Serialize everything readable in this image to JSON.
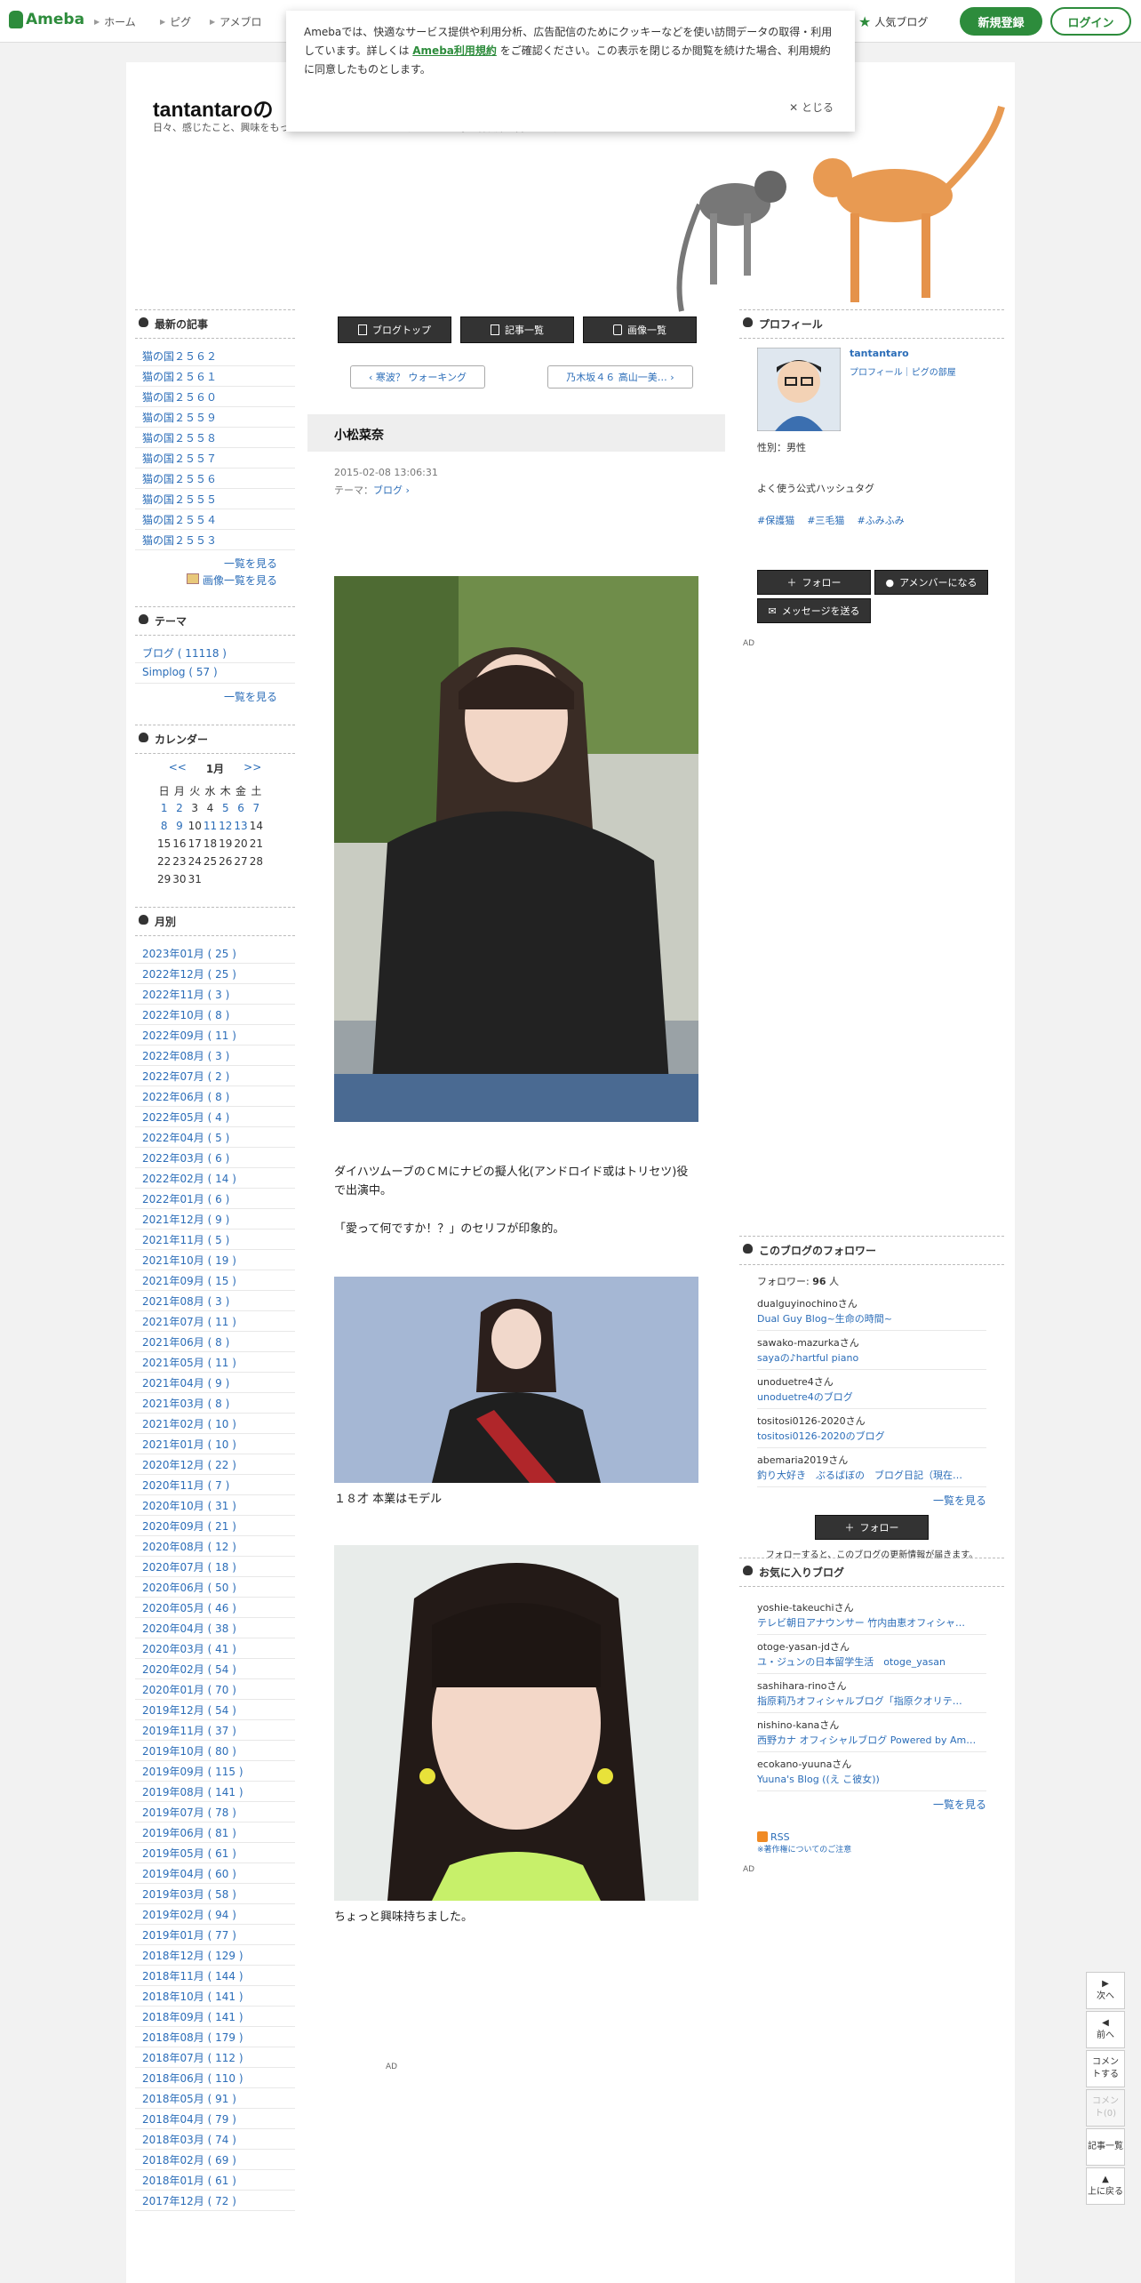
{
  "topbar": {
    "logo": "Ameba",
    "nav": [
      "ホーム",
      "ピグ",
      "アメブロ"
    ],
    "popular": "人気ブログ",
    "register": "新規登録",
    "login": "ログイン"
  },
  "cookie": {
    "text_before": "Amebaでは、快適なサービス提供や利用分析、広告配信のためにクッキーなどを使い訪問データの取得・利用しています。詳しくは ",
    "link": "Ameba利用規約",
    "text_after": " をご確認ください。この表示を閉じるか閲覧を続けた場合、利用規約に同意したものとします。",
    "close": "✕ とじる"
  },
  "blog": {
    "title": "tantantaroの",
    "description": "日々、感じたこと、興味をもったこと、… となっています。それでも時々猫以外も書きます。"
  },
  "latest": {
    "heading": "最新の記事",
    "items": [
      "猫の国２５６２",
      "猫の国２５６１",
      "猫の国２５６０",
      "猫の国２５５９",
      "猫の国２５５８",
      "猫の国２５５７",
      "猫の国２５５６",
      "猫の国２５５５",
      "猫の国２５５４",
      "猫の国２５５３"
    ],
    "more": "一覧を見る",
    "images": "画像一覧を見る"
  },
  "theme": {
    "heading": "テーマ",
    "items": [
      "ブログ ( 11118 )",
      "Simplog ( 57 )"
    ],
    "more": "一覧を見る"
  },
  "calendar": {
    "heading": "カレンダー",
    "prev": "<<",
    "month": "1月",
    "next": ">>",
    "days": [
      "日",
      "月",
      "火",
      "水",
      "木",
      "金",
      "土"
    ],
    "weeks": [
      [
        "1",
        "2",
        "3",
        "4",
        "5",
        "6",
        "7"
      ],
      [
        "8",
        "9",
        "10",
        "11",
        "12",
        "13",
        "14"
      ],
      [
        "15",
        "16",
        "17",
        "18",
        "19",
        "20",
        "21"
      ],
      [
        "22",
        "23",
        "24",
        "25",
        "26",
        "27",
        "28"
      ],
      [
        "29",
        "30",
        "31",
        "",
        "",
        "",
        ""
      ]
    ],
    "linked": [
      "1",
      "2",
      "5",
      "6",
      "7",
      "8",
      "9",
      "11",
      "12",
      "13"
    ]
  },
  "monthly": {
    "heading": "月別",
    "items": [
      "2023年01月 ( 25 )",
      "2022年12月 ( 25 )",
      "2022年11月 ( 3 )",
      "2022年10月 ( 8 )",
      "2022年09月 ( 11 )",
      "2022年08月 ( 3 )",
      "2022年07月 ( 2 )",
      "2022年06月 ( 8 )",
      "2022年05月 ( 4 )",
      "2022年04月 ( 5 )",
      "2022年03月 ( 6 )",
      "2022年02月 ( 14 )",
      "2022年01月 ( 6 )",
      "2021年12月 ( 9 )",
      "2021年11月 ( 5 )",
      "2021年10月 ( 19 )",
      "2021年09月 ( 15 )",
      "2021年08月 ( 3 )",
      "2021年07月 ( 11 )",
      "2021年06月 ( 8 )",
      "2021年05月 ( 11 )",
      "2021年04月 ( 9 )",
      "2021年03月 ( 8 )",
      "2021年02月 ( 10 )",
      "2021年01月 ( 10 )",
      "2020年12月 ( 22 )",
      "2020年11月 ( 7 )",
      "2020年10月 ( 31 )",
      "2020年09月 ( 21 )",
      "2020年08月 ( 12 )",
      "2020年07月 ( 18 )",
      "2020年06月 ( 50 )",
      "2020年05月 ( 46 )",
      "2020年04月 ( 38 )",
      "2020年03月 ( 41 )",
      "2020年02月 ( 54 )",
      "2020年01月 ( 70 )",
      "2019年12月 ( 54 )",
      "2019年11月 ( 37 )",
      "2019年10月 ( 80 )",
      "2019年09月 ( 115 )",
      "2019年08月 ( 141 )",
      "2019年07月 ( 78 )",
      "2019年06月 ( 81 )",
      "2019年05月 ( 61 )",
      "2019年04月 ( 60 )",
      "2019年03月 ( 58 )",
      "2019年02月 ( 94 )",
      "2019年01月 ( 77 )",
      "2018年12月 ( 129 )",
      "2018年11月 ( 144 )",
      "2018年10月 ( 141 )",
      "2018年09月 ( 141 )",
      "2018年08月 ( 179 )",
      "2018年07月 ( 112 )",
      "2018年06月 ( 110 )",
      "2018年05月 ( 91 )",
      "2018年04月 ( 79 )",
      "2018年03月 ( 74 )",
      "2018年02月 ( 69 )",
      "2018年01月 ( 61 )",
      "2017年12月 ( 72 )"
    ]
  },
  "menu": {
    "top": "ブログトップ",
    "list": "記事一覧",
    "images": "画像一覧"
  },
  "pager": {
    "prev": "寒波？ ウォーキング",
    "next": "乃木坂４６ 高山一美…"
  },
  "article": {
    "title": "小松菜奈",
    "date": "2015-02-08 13:06:31",
    "theme_label": "テーマ：",
    "theme": "ブログ",
    "p1": "ダイハツムーブのＣＭにナビの擬人化(アンドロイド或はトリセツ)役で出演中。",
    "p2": "「愛って何ですか！？」のセリフが印象的。",
    "caption1": "１８才 本業はモデル",
    "caption2": "ちょっと興味持ちました。",
    "ad": "AD"
  },
  "profile": {
    "heading": "プロフィール",
    "name": "tantantaro",
    "links": "プロフィール｜ピグの部屋",
    "gender": "性別：男性",
    "hashtag_title": "よく使う公式ハッシュタグ",
    "tags": [
      "#保護猫",
      "#三毛猫",
      "#ふみふみ"
    ],
    "follow": "フォロー",
    "member": "アメンバーになる",
    "message": "メッセージを送る",
    "ad": "AD"
  },
  "followers": {
    "heading": "このブログのフォロワー",
    "count_label": "フォロワー:",
    "count": "96",
    "unit": "人",
    "items": [
      {
        "user": "dualguyinochinoさん",
        "blog": "Dual Guy Blog~生命の時間~"
      },
      {
        "user": "sawako-mazurkaさん",
        "blog": "sayaの♪hartful piano"
      },
      {
        "user": "unoduetre4さん",
        "blog": "unoduetre4のブログ"
      },
      {
        "user": "tositosi0126-2020さん",
        "blog": "tositosi0126-2020のブログ"
      },
      {
        "user": "abemaria2019さん",
        "blog": "釣り大好き　ぶるばぼの　ブログ日記（現在…"
      }
    ],
    "more": "一覧を見る",
    "follow": "フォロー",
    "note": "フォローすると、このブログの更新情報が届きます。"
  },
  "favorites": {
    "heading": "お気に入りブログ",
    "items": [
      {
        "user": "yoshie-takeuchiさん",
        "blog": "テレビ朝日アナウンサー 竹内由恵オフィシャ…"
      },
      {
        "user": "otoge-yasan-jdさん",
        "blog": "ユ・ジュンの日本留学生活　otoge_yasan"
      },
      {
        "user": "sashihara-rinoさん",
        "blog": "指原莉乃オフィシャルブログ「指原クオリテ…"
      },
      {
        "user": "nishino-kanaさん",
        "blog": "西野カナ オフィシャルブログ Powered by Am…"
      },
      {
        "user": "ecokano-yuunaさん",
        "blog": "Yuuna's Blog ((え こ彼女))"
      }
    ],
    "more": "一覧を見る",
    "rss": "RSS",
    "copyright": "※著作権についてのご注意",
    "ad": "AD"
  },
  "float": {
    "next": "次へ",
    "prev": "前へ",
    "comment": "コメントする",
    "comment_count": "コメント(0)",
    "list": "記事一覧",
    "top": "上に戻る"
  }
}
